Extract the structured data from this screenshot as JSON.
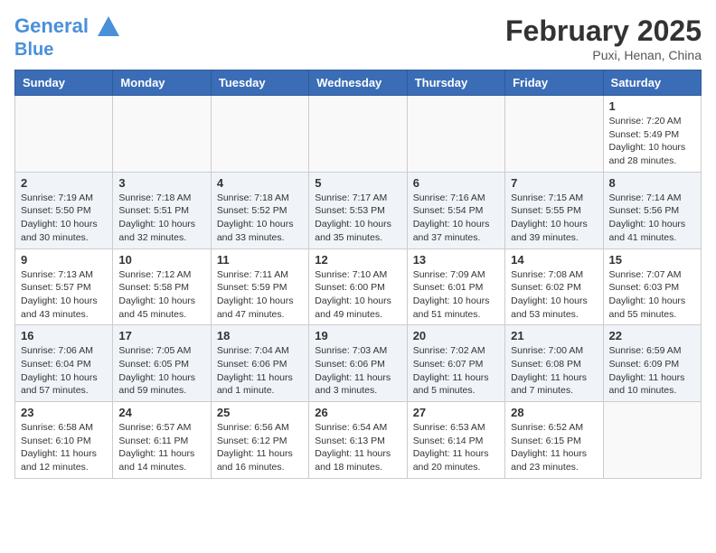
{
  "header": {
    "logo_line1": "General",
    "logo_line2": "Blue",
    "month_title": "February 2025",
    "location": "Puxi, Henan, China"
  },
  "weekdays": [
    "Sunday",
    "Monday",
    "Tuesday",
    "Wednesday",
    "Thursday",
    "Friday",
    "Saturday"
  ],
  "weeks": [
    [
      {
        "day": "",
        "info": ""
      },
      {
        "day": "",
        "info": ""
      },
      {
        "day": "",
        "info": ""
      },
      {
        "day": "",
        "info": ""
      },
      {
        "day": "",
        "info": ""
      },
      {
        "day": "",
        "info": ""
      },
      {
        "day": "1",
        "info": "Sunrise: 7:20 AM\nSunset: 5:49 PM\nDaylight: 10 hours and 28 minutes."
      }
    ],
    [
      {
        "day": "2",
        "info": "Sunrise: 7:19 AM\nSunset: 5:50 PM\nDaylight: 10 hours and 30 minutes."
      },
      {
        "day": "3",
        "info": "Sunrise: 7:18 AM\nSunset: 5:51 PM\nDaylight: 10 hours and 32 minutes."
      },
      {
        "day": "4",
        "info": "Sunrise: 7:18 AM\nSunset: 5:52 PM\nDaylight: 10 hours and 33 minutes."
      },
      {
        "day": "5",
        "info": "Sunrise: 7:17 AM\nSunset: 5:53 PM\nDaylight: 10 hours and 35 minutes."
      },
      {
        "day": "6",
        "info": "Sunrise: 7:16 AM\nSunset: 5:54 PM\nDaylight: 10 hours and 37 minutes."
      },
      {
        "day": "7",
        "info": "Sunrise: 7:15 AM\nSunset: 5:55 PM\nDaylight: 10 hours and 39 minutes."
      },
      {
        "day": "8",
        "info": "Sunrise: 7:14 AM\nSunset: 5:56 PM\nDaylight: 10 hours and 41 minutes."
      }
    ],
    [
      {
        "day": "9",
        "info": "Sunrise: 7:13 AM\nSunset: 5:57 PM\nDaylight: 10 hours and 43 minutes."
      },
      {
        "day": "10",
        "info": "Sunrise: 7:12 AM\nSunset: 5:58 PM\nDaylight: 10 hours and 45 minutes."
      },
      {
        "day": "11",
        "info": "Sunrise: 7:11 AM\nSunset: 5:59 PM\nDaylight: 10 hours and 47 minutes."
      },
      {
        "day": "12",
        "info": "Sunrise: 7:10 AM\nSunset: 6:00 PM\nDaylight: 10 hours and 49 minutes."
      },
      {
        "day": "13",
        "info": "Sunrise: 7:09 AM\nSunset: 6:01 PM\nDaylight: 10 hours and 51 minutes."
      },
      {
        "day": "14",
        "info": "Sunrise: 7:08 AM\nSunset: 6:02 PM\nDaylight: 10 hours and 53 minutes."
      },
      {
        "day": "15",
        "info": "Sunrise: 7:07 AM\nSunset: 6:03 PM\nDaylight: 10 hours and 55 minutes."
      }
    ],
    [
      {
        "day": "16",
        "info": "Sunrise: 7:06 AM\nSunset: 6:04 PM\nDaylight: 10 hours and 57 minutes."
      },
      {
        "day": "17",
        "info": "Sunrise: 7:05 AM\nSunset: 6:05 PM\nDaylight: 10 hours and 59 minutes."
      },
      {
        "day": "18",
        "info": "Sunrise: 7:04 AM\nSunset: 6:06 PM\nDaylight: 11 hours and 1 minute."
      },
      {
        "day": "19",
        "info": "Sunrise: 7:03 AM\nSunset: 6:06 PM\nDaylight: 11 hours and 3 minutes."
      },
      {
        "day": "20",
        "info": "Sunrise: 7:02 AM\nSunset: 6:07 PM\nDaylight: 11 hours and 5 minutes."
      },
      {
        "day": "21",
        "info": "Sunrise: 7:00 AM\nSunset: 6:08 PM\nDaylight: 11 hours and 7 minutes."
      },
      {
        "day": "22",
        "info": "Sunrise: 6:59 AM\nSunset: 6:09 PM\nDaylight: 11 hours and 10 minutes."
      }
    ],
    [
      {
        "day": "23",
        "info": "Sunrise: 6:58 AM\nSunset: 6:10 PM\nDaylight: 11 hours and 12 minutes."
      },
      {
        "day": "24",
        "info": "Sunrise: 6:57 AM\nSunset: 6:11 PM\nDaylight: 11 hours and 14 minutes."
      },
      {
        "day": "25",
        "info": "Sunrise: 6:56 AM\nSunset: 6:12 PM\nDaylight: 11 hours and 16 minutes."
      },
      {
        "day": "26",
        "info": "Sunrise: 6:54 AM\nSunset: 6:13 PM\nDaylight: 11 hours and 18 minutes."
      },
      {
        "day": "27",
        "info": "Sunrise: 6:53 AM\nSunset: 6:14 PM\nDaylight: 11 hours and 20 minutes."
      },
      {
        "day": "28",
        "info": "Sunrise: 6:52 AM\nSunset: 6:15 PM\nDaylight: 11 hours and 23 minutes."
      },
      {
        "day": "",
        "info": ""
      }
    ]
  ]
}
